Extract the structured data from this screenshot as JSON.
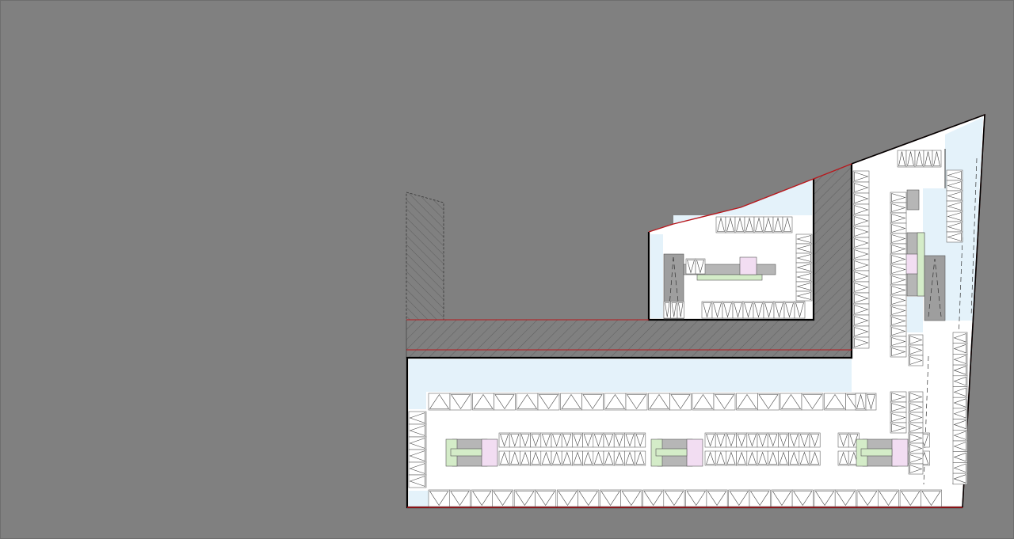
{
  "canvas": {
    "background": "#808080",
    "border_color": "#6e6e6e"
  },
  "palette": {
    "building_fill": "#ffffff",
    "wall": "#000000",
    "boundary_line": "#b8181d",
    "landscape_zone": "#e4f2fa",
    "core_gray": "#b6b6b6",
    "shaft_dark": "#9e9e9e",
    "core_green": "#d4ecc8",
    "core_pink": "#f2ddf2",
    "stall_line": "#444444",
    "hatch": "#444444"
  },
  "plan": {
    "type": "parking-level-floor-plan",
    "parking_symbol": "triangle"
  }
}
